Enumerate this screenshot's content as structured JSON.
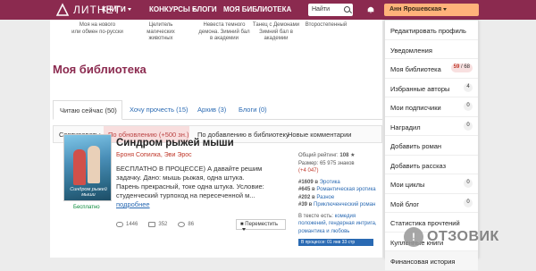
{
  "header": {
    "logo_text": "ЛИТНЕТ",
    "nav": [
      "КНИГИ",
      "КОНКУРСЫ",
      "БЛОГИ",
      "МОЯ БИБЛИОТЕКА"
    ],
    "search_placeholder": "Найти",
    "user_name": "Анн Ярошевская"
  },
  "colors": {
    "brand": "#8b2a4f",
    "accent": "#ffb27a",
    "link": "#2a6ab3"
  },
  "strip": [
    "Моя на нового\nили обмен по-русски",
    "Целитель\nмагических\nживотных",
    "Невеста темного\nдемона. Зимний бал\nв академии",
    "Танец с Демонами\nЗимний бал в\nакадемии",
    "Второстепенный"
  ],
  "page": {
    "title": "Моя библиотека",
    "tabs": [
      "Читаю сейчас (50)",
      "Хочу прочесть (15)",
      "Архив (3)",
      "Блоги (0)"
    ],
    "sort_label": "Сортировать:",
    "sort_options": [
      "По обновлению (+500 зн.)",
      "По добавлению в библиотеку",
      "Новые комментарии"
    ]
  },
  "book": {
    "cover_title": "Синдром рыжей мыши",
    "badge": "Бесплатно",
    "title": "Синдром рыжей мыши",
    "authors": "Броня Сопилка, Эви Эрос",
    "description": "БЕСПЛАТНО В ПРОЦЕССЕ) А давайте решим задачку. Дано: мышь рыжая, одна штука. Парень прекрасный, токе одна штука. Условие: студенческий турпоход на пересеченной м...",
    "more": "подробнее",
    "views": "1446",
    "likes": "352",
    "comments": "86",
    "move_button": "Переместить",
    "rating_label": "Общий рейтинг:",
    "rating_value": "108",
    "size_label": "Размер:",
    "size_value": "65 975 знаков",
    "size_delta": "(+4 047)",
    "ranks": [
      {
        "num": "#1609 в",
        "genre": "Эротика"
      },
      {
        "num": "#645 в",
        "genre": "Романтическая эротика"
      },
      {
        "num": "#202 в",
        "genre": "Разное"
      },
      {
        "num": "#39 в",
        "genre": "Приключенческий роман"
      }
    ],
    "tags_label": "В тексте есть:",
    "tags": "комедия положений, гендерная интрига, романтика и любовь",
    "progress": "В процессе: 01 янв 33 стр"
  },
  "menu": [
    {
      "label": "Редактировать профиль"
    },
    {
      "label": "Уведомления"
    },
    {
      "label": "Моя библиотека",
      "badge_red": "59",
      "badge_total": "/ 68"
    },
    {
      "label": "Избранные авторы",
      "badge": "4"
    },
    {
      "label": "Мои подписчики",
      "badge": "0"
    },
    {
      "label": "Наградил",
      "badge": "0"
    },
    {
      "label": "Добавить роман"
    },
    {
      "label": "Добавить рассказ"
    },
    {
      "label": "Мои циклы",
      "badge": "0"
    },
    {
      "label": "Мой блог",
      "badge": "0"
    },
    {
      "label": "Статистика прочтений"
    },
    {
      "label": "Купленные книги"
    },
    {
      "label": "Финансовая история"
    }
  ],
  "watermark": "ОТЗОВИК"
}
